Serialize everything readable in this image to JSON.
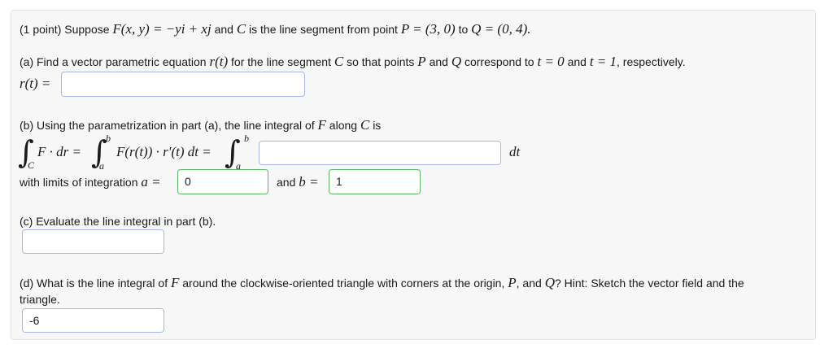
{
  "header": {
    "points": "(1 point)",
    "suppose": "Suppose",
    "f_def": "F(x, y) = −yi + xj",
    "and_c": "and",
    "c_desc": "C",
    "is_line": "is the line segment from point",
    "p_eq": "P = (3, 0)",
    "to": "to",
    "q_eq": "Q = (0, 4)."
  },
  "part_a": {
    "label": "(a) Find a vector parametric equation",
    "rt": "r(t)",
    "rest1": "for the line segment",
    "c": "C",
    "rest2": "so that points",
    "p": "P",
    "and": "and",
    "q": "Q",
    "rest3": "correspond to",
    "t0": "t = 0",
    "and2": "and",
    "t1": "t = 1",
    "rest4": ", respectively.",
    "prefix": "r(t) =",
    "answer": ""
  },
  "part_b": {
    "label": "(b) Using the parametrization in part (a), the line integral of",
    "f": "F",
    "along": "along",
    "c": "C",
    "is": "is",
    "integrand_lhs": "F · dr =",
    "sub_c": "C",
    "lim_b": "b",
    "lim_a": "a",
    "integrand_mid": "F(r(t)) · r′(t) dt =",
    "answer": "",
    "dt": "dt",
    "limits_label": "with limits of integration",
    "a_eq": "a =",
    "a_value": "0",
    "and_b": "and",
    "b_eq": "b =",
    "b_value": "1"
  },
  "part_c": {
    "label": "(c) Evaluate the line integral in part (b).",
    "answer": ""
  },
  "part_d": {
    "label1": "(d) What is the line integral of",
    "f": "F",
    "label2": "around the clockwise-oriented triangle with corners at the origin,",
    "p": "P",
    "comma": ", and",
    "q": "Q",
    "label3": "? Hint: Sketch the vector field and the",
    "label4": "triangle.",
    "answer": "-6"
  }
}
